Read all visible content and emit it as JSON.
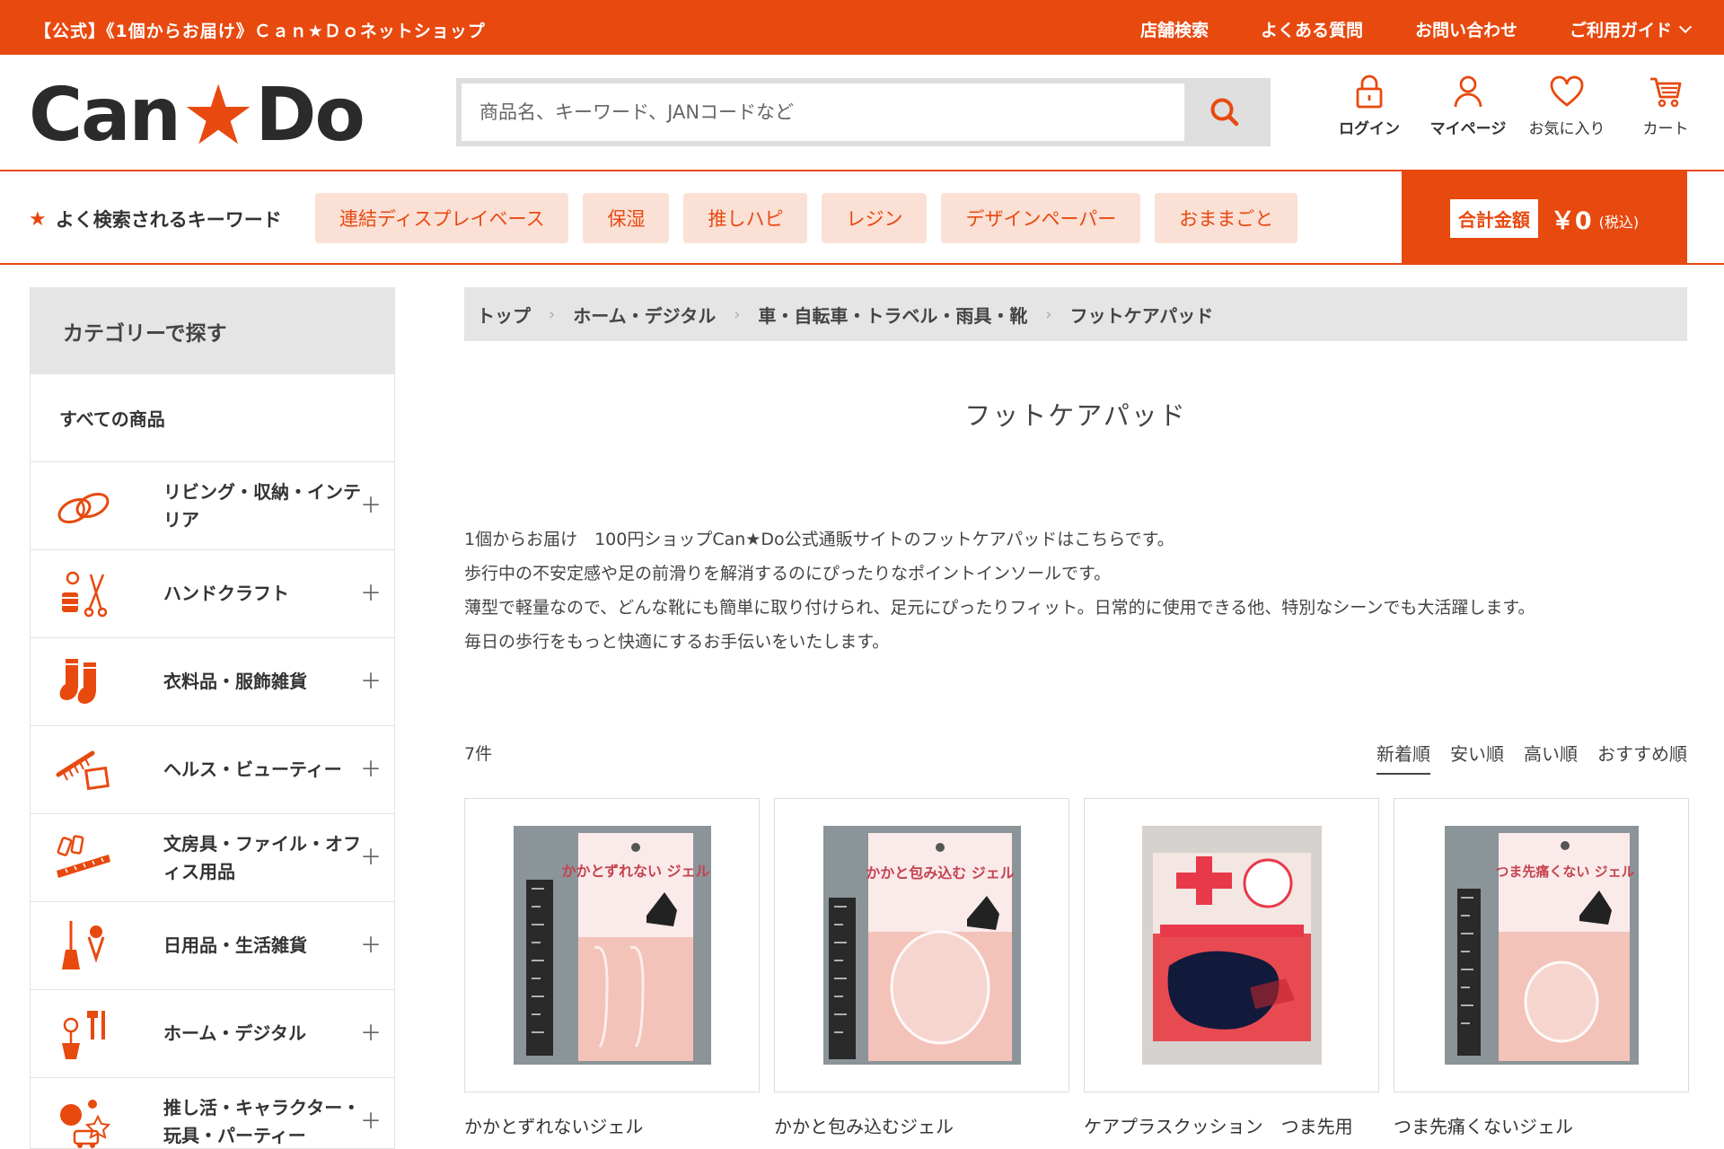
{
  "topbar": {
    "site_title": "【公式】《1個からお届け》Ｃａｎ★Ｄｏネットショップ",
    "nav": [
      {
        "label": "店舗検索"
      },
      {
        "label": "よくある質問"
      },
      {
        "label": "お問い合わせ"
      },
      {
        "label": "ご利用ガイド"
      }
    ]
  },
  "logo": {
    "text_left": "Can",
    "star": "★",
    "text_right": "Do"
  },
  "search": {
    "placeholder": "商品名、キーワード、JANコードなど",
    "value": ""
  },
  "header_icons": [
    {
      "label": "ログイン",
      "icon": "lock-icon"
    },
    {
      "label": "マイページ",
      "icon": "user-icon"
    },
    {
      "label": "お気に入り",
      "icon": "heart-icon"
    },
    {
      "label": "カート",
      "icon": "cart-icon"
    }
  ],
  "keywords": {
    "title": "よく検索されるキーワード",
    "items": [
      "連結ディスプレイベース",
      "保湿",
      "推しハピ",
      "レジン",
      "デザインペーパー",
      "おままごと"
    ]
  },
  "cart_total": {
    "label": "合計金額",
    "amount": "￥0",
    "tax": "(税込)"
  },
  "sidebar": {
    "title": "カテゴリーで探す",
    "all_label": "すべての商品",
    "items": [
      {
        "label": "リビング・収納・インテリア",
        "icon": "slippers-icon"
      },
      {
        "label": "ハンドクラフト",
        "icon": "craft-tools-icon"
      },
      {
        "label": "衣料品・服飾雑貨",
        "icon": "socks-icon"
      },
      {
        "label": "ヘルス・ビューティー",
        "icon": "comb-mirror-icon"
      },
      {
        "label": "文房具・ファイル・オフィス用品",
        "icon": "stationery-icon"
      },
      {
        "label": "日用品・生活雑貨",
        "icon": "broom-icon"
      },
      {
        "label": "ホーム・デジタル",
        "icon": "home-tools-icon"
      },
      {
        "label": "推し活・キャラクター・玩具・パーティー",
        "icon": "toys-icon"
      }
    ]
  },
  "breadcrumb": [
    "トップ",
    "ホーム・デジタル",
    "車・自転車・トラベル・雨具・靴",
    "フットケアパッド"
  ],
  "page_title": "フットケアパッド",
  "description": [
    "1個からお届け　100円ショップCan★Do公式通販サイトのフットケアパッドはこちらです。",
    "歩行中の不安定感や足の前滑りを解消するのにぴったりなポイントインソールです。",
    "薄型で軽量なので、どんな靴にも簡単に取り付けられ、足元にぴったりフィット。日常的に使用できる他、特別なシーンでも大活躍します。",
    "毎日の歩行をもっと快適にするお手伝いをいたします。"
  ],
  "count": "7件",
  "sort_options": [
    "新着順",
    "安い順",
    "高い順",
    "おすすめ順"
  ],
  "sort_selected": "新着順",
  "products": [
    {
      "name": "かかとずれないジェル",
      "package_text": "かかとずれない ジェル"
    },
    {
      "name": "かかと包み込むジェル",
      "package_text": "かかと包み込む ジェル"
    },
    {
      "name": "ケアプラスクッション　つま先用",
      "package_text": ""
    },
    {
      "name": "つま先痛くないジェル",
      "package_text": "つま先痛くない ジェル"
    }
  ],
  "colors": {
    "brand": "#e8490f",
    "chip_bg": "#fbe0d6",
    "panel_gray": "#e5e5e5"
  }
}
